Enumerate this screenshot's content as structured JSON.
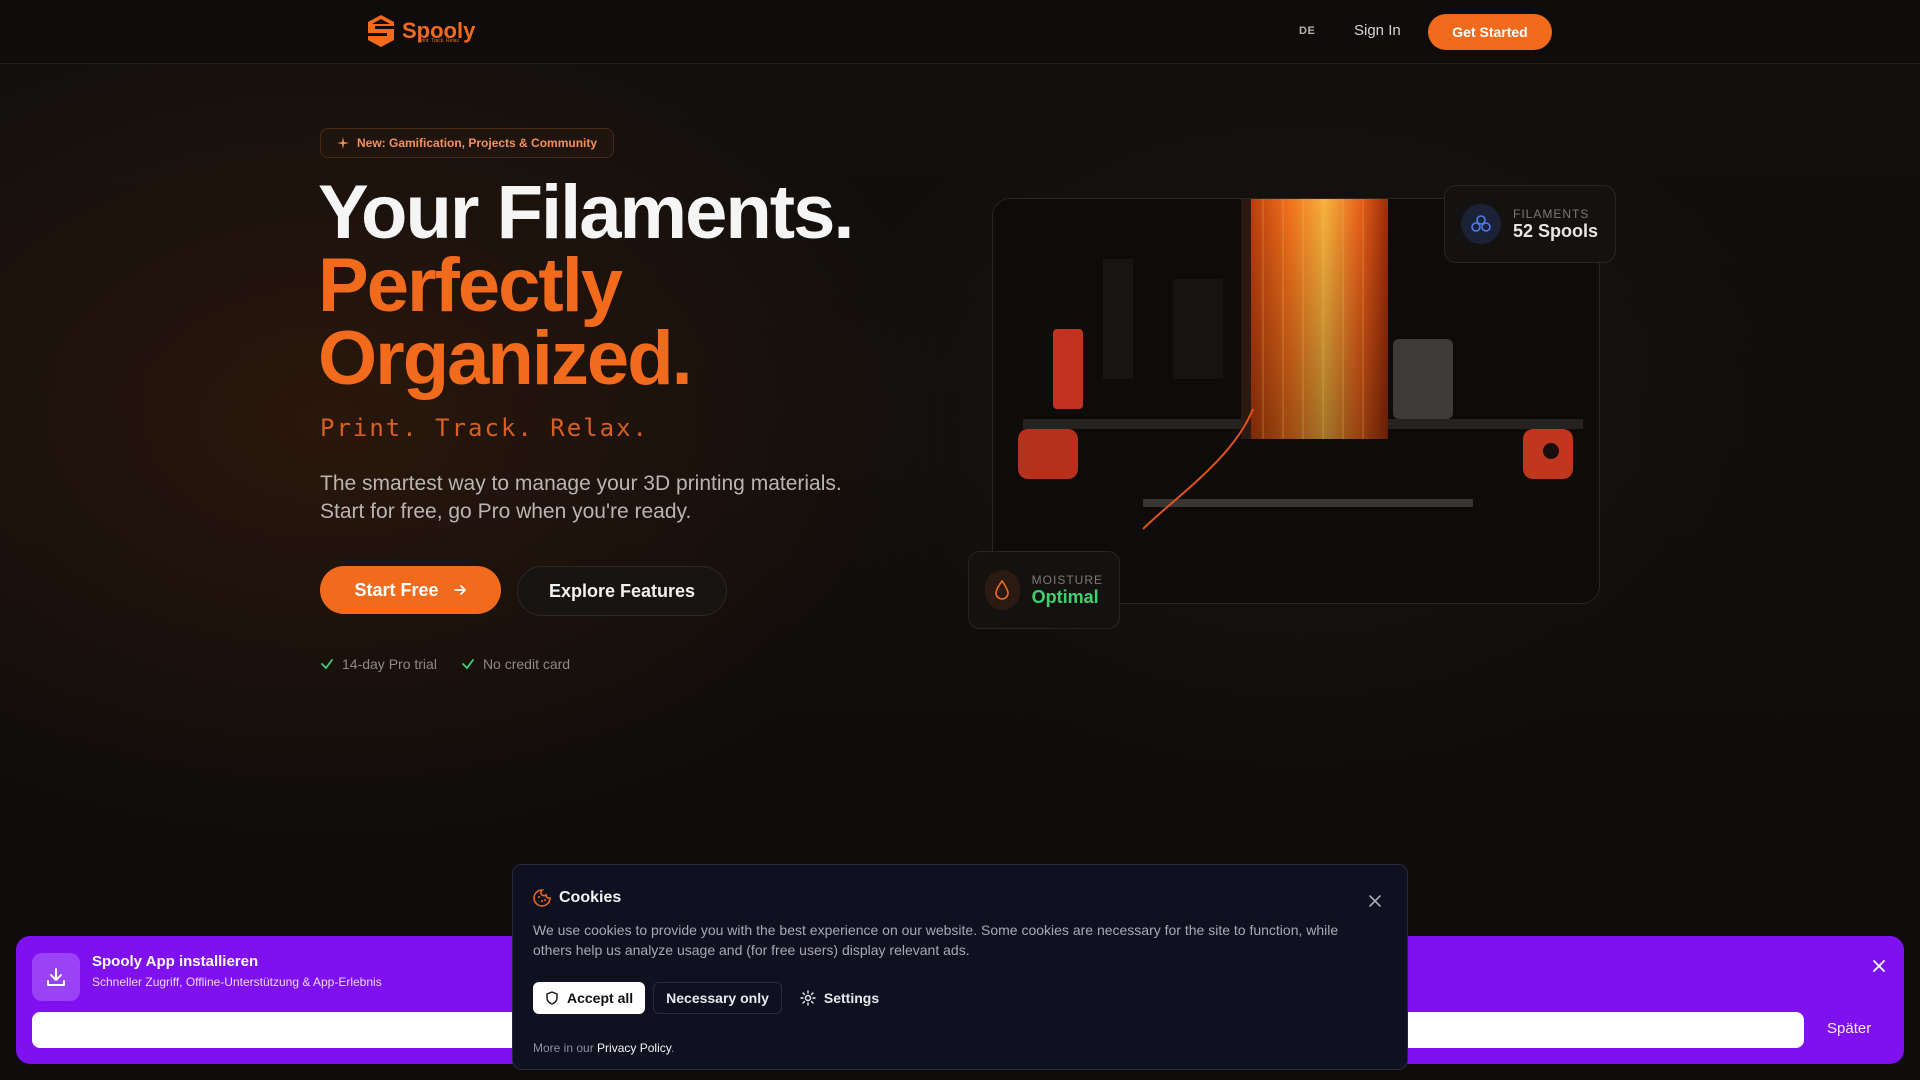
{
  "brand": {
    "name": "Spooly",
    "tagline": "Print. Track. Relax.",
    "color": "#f26b1d"
  },
  "nav": {
    "lang": "DE",
    "signin": "Sign In",
    "cta": "Get Started"
  },
  "hero": {
    "badge": "New: Gamification, Projects & Community",
    "title_line1": "Your Filaments.",
    "title_line2": "Perfectly",
    "title_line3": "Organized.",
    "tagline": "Print. Track. Relax.",
    "desc_line1": "The smartest way to manage your 3D printing materials.",
    "desc_line2": "Start for free, go Pro when you're ready.",
    "primary_btn": "Start Free",
    "secondary_btn": "Explore Features",
    "checks": [
      "14-day Pro trial",
      "No credit card"
    ]
  },
  "stats": {
    "filaments_label": "FILAMENTS",
    "filaments_value": "52 Spools",
    "moisture_label": "MOISTURE",
    "moisture_value": "Optimal",
    "moisture_color": "#3fd16d"
  },
  "install": {
    "title": "Spooly App installieren",
    "subtitle": "Schneller Zugriff, Offline-Unterstützung & App-Erlebnis",
    "later": "Später",
    "color": "#7f10f0"
  },
  "cookies": {
    "title": "Cookies",
    "text": "We use cookies to provide you with the best experience on our website. Some cookies are necessary for the site to function, while others help us analyze usage and (for free users) display relevant ads.",
    "accept": "Accept all",
    "necessary": "Necessary only",
    "settings": "Settings",
    "more_prefix": "More in our",
    "privacy": "Privacy Policy",
    "more_suffix": "."
  },
  "icons": [
    "logo-icon",
    "sparkle-icon",
    "arrow-right-icon",
    "check-icon",
    "spools-icon",
    "droplet-icon",
    "download-icon",
    "close-icon",
    "cookie-icon",
    "shield-icon",
    "gear-icon"
  ]
}
